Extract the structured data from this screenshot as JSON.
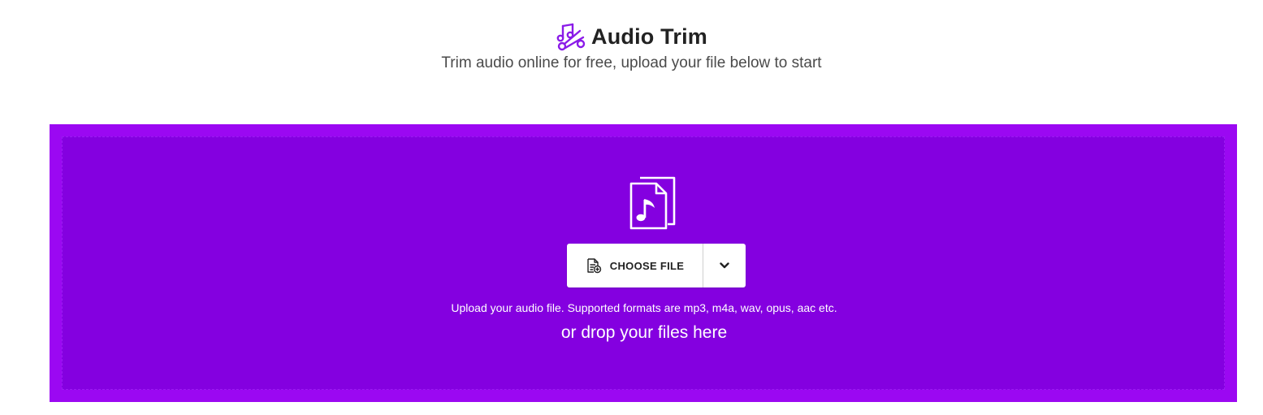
{
  "header": {
    "title": "Audio Trim",
    "subtitle": "Trim audio online for free, upload your file below to start",
    "icon": "audio-trim-icon"
  },
  "upload": {
    "file_icon": "audio-file-icon",
    "choose_label": "CHOOSE FILE",
    "choose_icon": "add-file-icon",
    "dropdown_icon": "chevron-down-icon",
    "formats_text": "Upload your audio file. Supported formats are mp3, m4a, wav, opus, aac etc.",
    "drop_text": "or drop your files here"
  },
  "colors": {
    "accent": "#9b08f2",
    "dropzone_inner": "#8400e0",
    "title_text": "#222222",
    "subtitle_text": "#4a4a4a"
  }
}
